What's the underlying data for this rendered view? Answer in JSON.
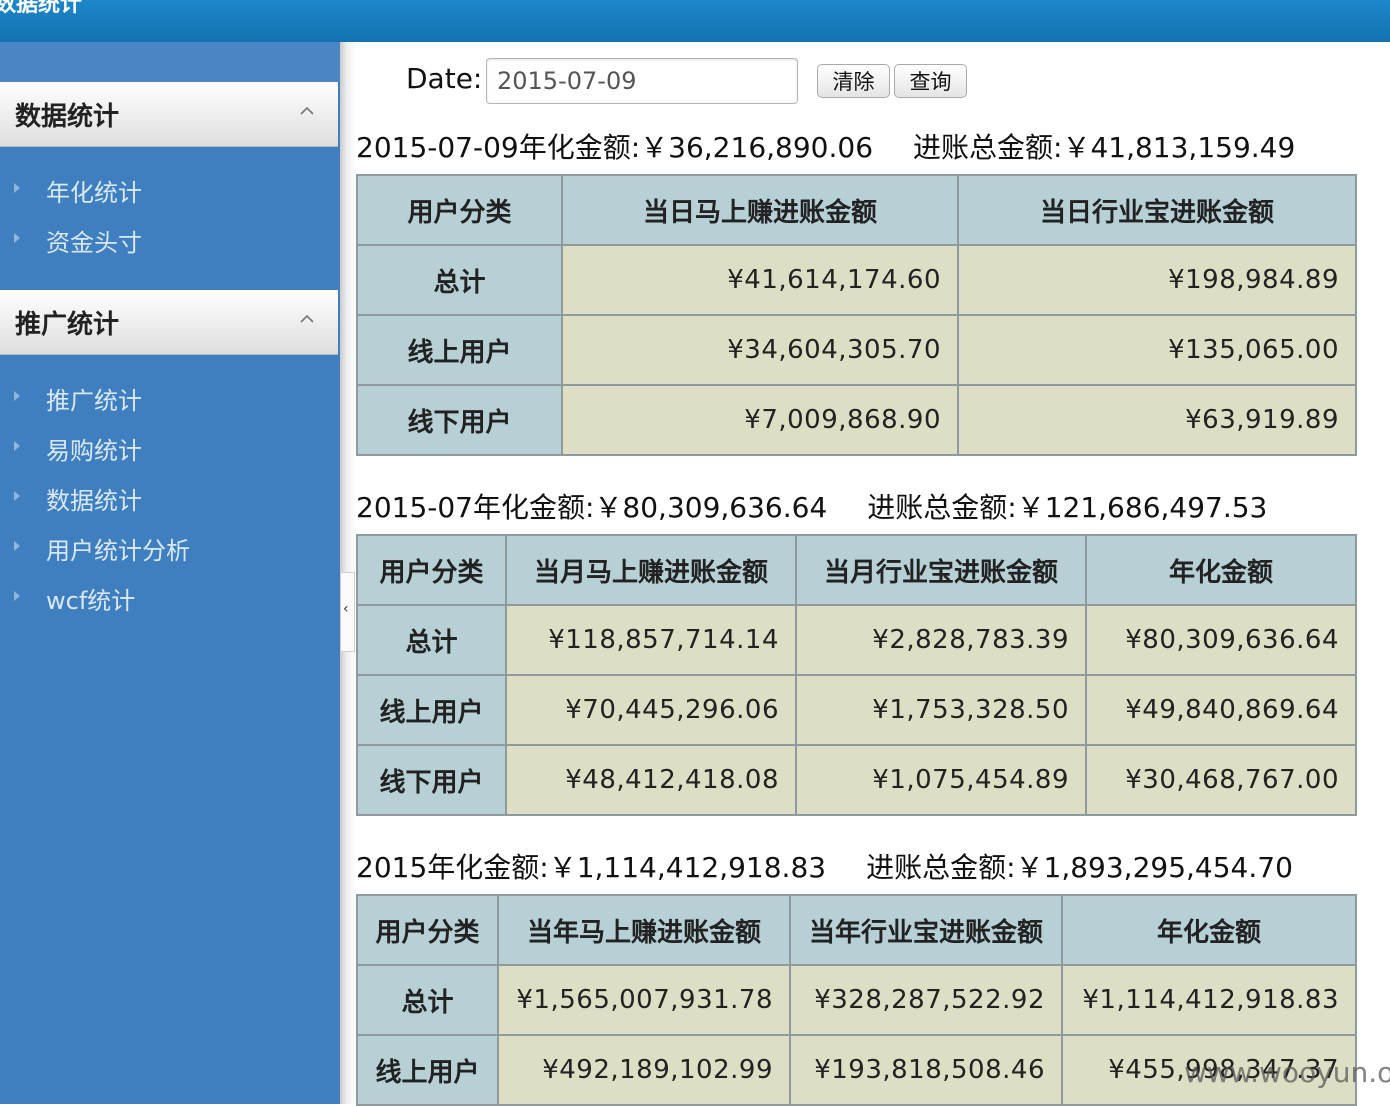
{
  "app": {
    "title": "数据统计"
  },
  "sidebar": {
    "groups": [
      {
        "label": "数据统计",
        "items": [
          {
            "label": "年化统计"
          },
          {
            "label": "资金头寸"
          }
        ]
      },
      {
        "label": "推广统计",
        "items": [
          {
            "label": "推广统计"
          },
          {
            "label": "易购统计"
          },
          {
            "label": "数据统计"
          },
          {
            "label": "用户统计分析"
          },
          {
            "label": "wcf统计"
          }
        ]
      }
    ]
  },
  "filter": {
    "date_label": "Date:",
    "date_value": "2015-07-09",
    "clear_label": "清除",
    "query_label": "查询"
  },
  "sections": [
    {
      "summary": {
        "annual": "2015-07-09年化金额:￥36,216,890.06",
        "total": "进账总金额:￥41,813,159.49"
      },
      "headers": [
        "用户分类",
        "当日马上赚进账金额",
        "当日行业宝进账金额"
      ],
      "rows": [
        {
          "category": "总计",
          "values": [
            "¥41,614,174.60",
            "¥198,984.89"
          ]
        },
        {
          "category": "线上用户",
          "values": [
            "¥34,604,305.70",
            "¥135,065.00"
          ]
        },
        {
          "category": "线下用户",
          "values": [
            "¥7,009,868.90",
            "¥63,919.89"
          ]
        }
      ]
    },
    {
      "summary": {
        "annual": "2015-07年化金额:￥80,309,636.64",
        "total": "进账总金额:￥121,686,497.53"
      },
      "headers": [
        "用户分类",
        "当月马上赚进账金额",
        "当月行业宝进账金额",
        "年化金额"
      ],
      "rows": [
        {
          "category": "总计",
          "values": [
            "¥118,857,714.14",
            "¥2,828,783.39",
            "¥80,309,636.64"
          ]
        },
        {
          "category": "线上用户",
          "values": [
            "¥70,445,296.06",
            "¥1,753,328.50",
            "¥49,840,869.64"
          ]
        },
        {
          "category": "线下用户",
          "values": [
            "¥48,412,418.08",
            "¥1,075,454.89",
            "¥30,468,767.00"
          ]
        }
      ]
    },
    {
      "summary": {
        "annual": "2015年化金额:￥1,114,412,918.83",
        "total": "进账总金额:￥1,893,295,454.70"
      },
      "headers": [
        "用户分类",
        "当年马上赚进账金额",
        "当年行业宝进账金额",
        "年化金额"
      ],
      "rows": [
        {
          "category": "总计",
          "values": [
            "¥1,565,007,931.78",
            "¥328,287,522.92",
            "¥1,114,412,918.83"
          ]
        },
        {
          "category": "线上用户",
          "values": [
            "¥492,189,102.99",
            "¥193,818,508.46",
            "¥455,998,347.37"
          ]
        }
      ]
    }
  ],
  "watermark": "www.wooyun.org"
}
